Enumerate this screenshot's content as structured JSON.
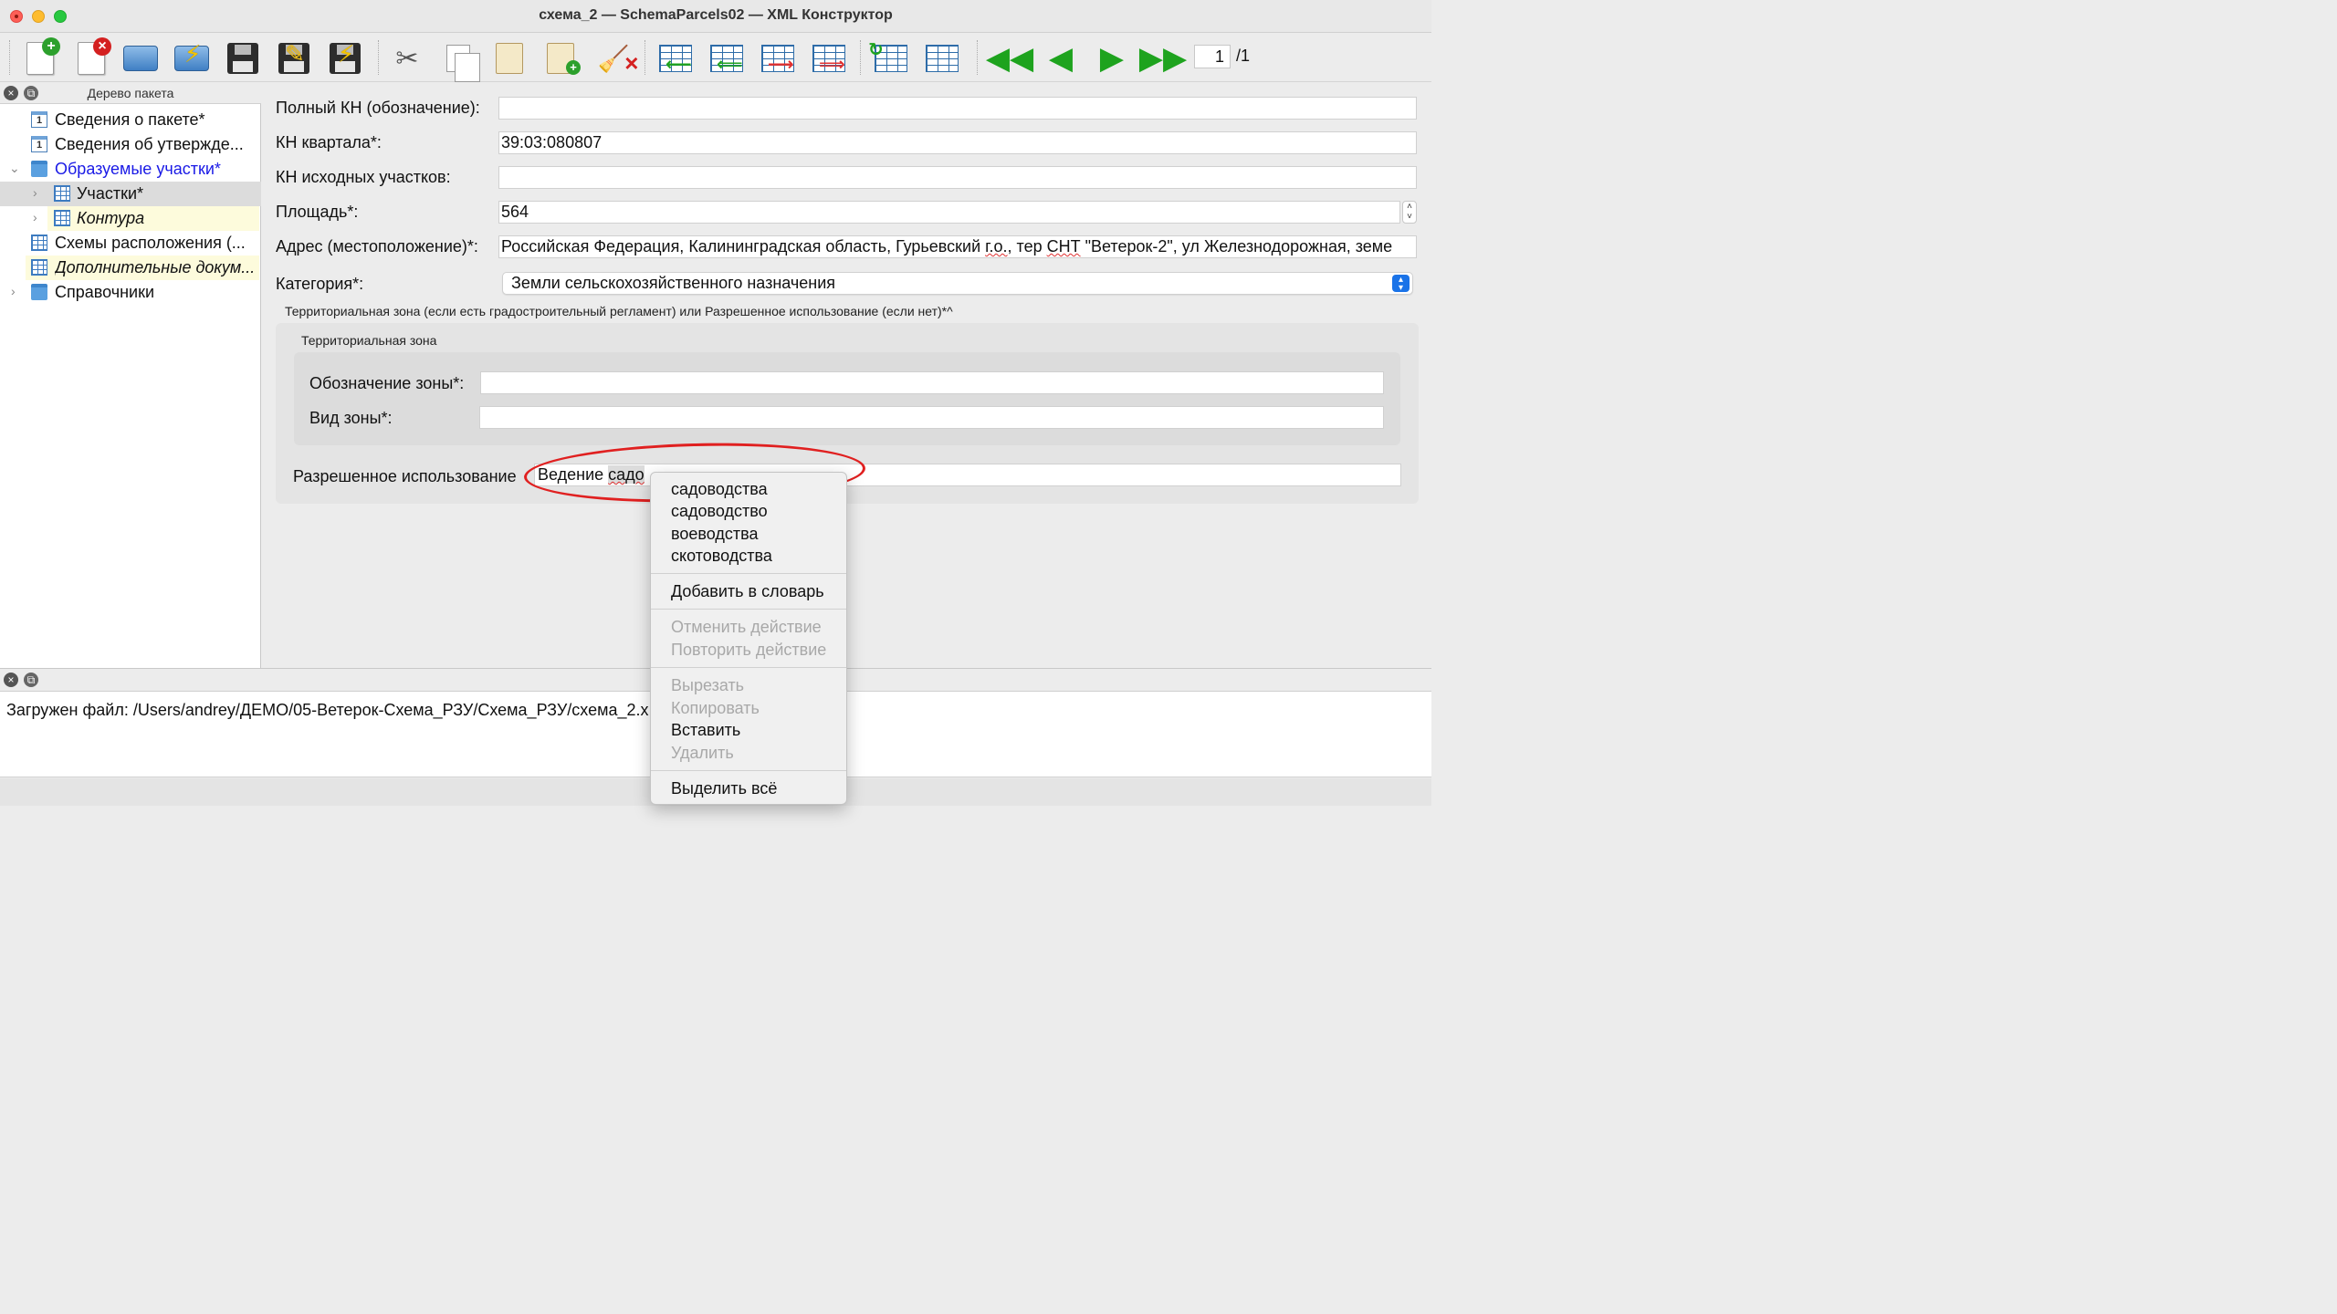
{
  "window": {
    "title": "схема_2 — SchemaParcels02 — XML Конструктор"
  },
  "toolbar": {
    "page_current": "1",
    "page_total": "/1",
    "buttons": [
      {
        "name": "new-document",
        "icon": "document-plus-icon"
      },
      {
        "name": "close-document",
        "icon": "document-close-icon"
      },
      {
        "name": "print",
        "icon": "printer-icon"
      },
      {
        "name": "print-quick",
        "icon": "printer-bolt-icon"
      },
      {
        "name": "save",
        "icon": "floppy-icon"
      },
      {
        "name": "save-as",
        "icon": "floppy-pencil-icon"
      },
      {
        "name": "save-quick",
        "icon": "floppy-bolt-icon"
      },
      {
        "name": "cut",
        "icon": "scissors-icon"
      },
      {
        "name": "copy",
        "icon": "copy-icon"
      },
      {
        "name": "paste",
        "icon": "clipboard-icon"
      },
      {
        "name": "paste-new",
        "icon": "clipboard-plus-icon"
      },
      {
        "name": "clear",
        "icon": "broom-icon"
      },
      {
        "name": "insert-row-before",
        "icon": "table-arrow-left-icon"
      },
      {
        "name": "insert-row-after",
        "icon": "table-arrow-left2-icon"
      },
      {
        "name": "move-row",
        "icon": "table-arrow-right-icon"
      },
      {
        "name": "delete-row",
        "icon": "table-arrow-right-red-icon"
      },
      {
        "name": "table-refresh",
        "icon": "table-refresh-icon"
      },
      {
        "name": "table-columns",
        "icon": "table-columns-icon"
      },
      {
        "name": "first-page",
        "icon": "double-left-arrow-icon"
      },
      {
        "name": "prev-page",
        "icon": "left-arrow-icon"
      },
      {
        "name": "next-page",
        "icon": "right-arrow-icon"
      },
      {
        "name": "last-page",
        "icon": "double-right-arrow-icon"
      }
    ]
  },
  "tree_panel": {
    "title": "Дерево пакета",
    "items": [
      {
        "label": "Сведения о пакете*",
        "icon": "info-doc-icon"
      },
      {
        "label": "Сведения об утвержде...",
        "icon": "info-doc-icon"
      },
      {
        "label": "Образуемые участки*",
        "icon": "folder-icon",
        "expanded": true
      },
      {
        "label": "Участки*",
        "icon": "table-icon",
        "selected": true
      },
      {
        "label": "Контура",
        "icon": "table-icon"
      },
      {
        "label": "Схемы расположения (...",
        "icon": "table-icon"
      },
      {
        "label": "Дополнительные докум...",
        "icon": "table-icon"
      },
      {
        "label": "Справочники",
        "icon": "folder-icon"
      }
    ]
  },
  "form": {
    "full_kn_label": "Полный КН (обозначение):",
    "full_kn_value": "",
    "kn_quarter_label": "КН квартала*:",
    "kn_quarter_value": "39:03:080807",
    "kn_source_label": "КН исходных участков:",
    "kn_source_value": "",
    "area_label": "Площадь*:",
    "area_value": "564",
    "address_label": "Адрес (местоположение)*:",
    "address_value_part1": "Российская Федерация, Калининградская область, Гурьевский ",
    "address_value_go": "г.о.",
    "address_value_part2": ", тер ",
    "address_value_snt": "СНТ",
    "address_value_part3": " \"Ветерок-2\", ул Железнодорожная, земе",
    "category_label": "Категория*:",
    "category_value": "Земли сельскохозяйственного назначения",
    "zone_group_title": "Территориальная зона (если есть градостроительный регламент) или Разрешенное использование (если нет)*^",
    "terr_zone_title": "Территориальная зона",
    "zone_designation_label": "Обозначение зоны*:",
    "zone_designation_value": "",
    "zone_type_label": "Вид зоны*:",
    "zone_type_value": "",
    "permitted_use_label": "Разрешенное использование",
    "permitted_use_value_plain": "Ведение ",
    "permitted_use_value_selected": "садо"
  },
  "context_menu": {
    "suggestions": [
      "садоводства",
      "садоводство",
      "воеводства",
      "скотоводства"
    ],
    "add_to_dictionary": "Добавить в словарь",
    "undo": "Отменить действие",
    "redo": "Повторить действие",
    "cut": "Вырезать",
    "copy": "Копировать",
    "paste": "Вставить",
    "delete": "Удалить",
    "select_all": "Выделить всё"
  },
  "log_panel": {
    "message": "Загружен файл: /Users/andrey/ДЕМО/05-Ветерок-Схема_РЗУ/Схема_РЗУ/схема_2.x"
  },
  "colors": {
    "selection_link": "#1a1ae6",
    "annotation_red": "#e02020",
    "select_accent": "#1a73e8",
    "nav_green": "#1ea31e"
  }
}
